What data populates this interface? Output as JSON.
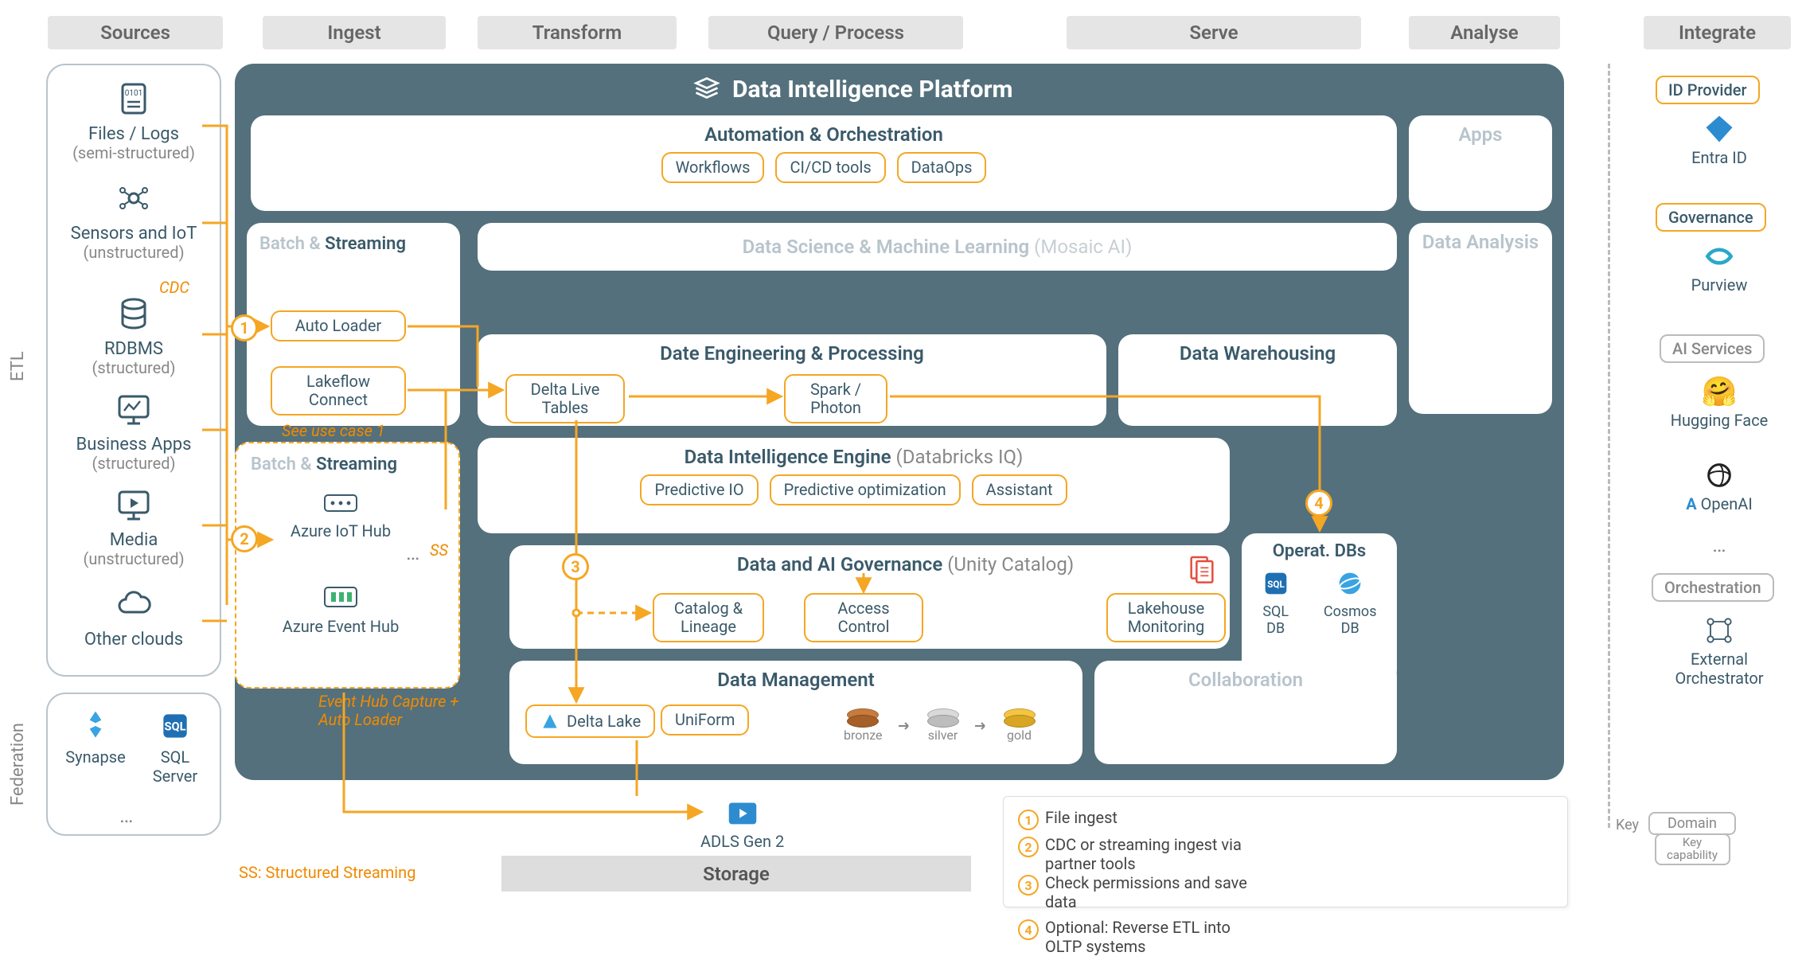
{
  "columns": {
    "sources": "Sources",
    "ingest": "Ingest",
    "transform": "Transform",
    "query": "Query / Process",
    "serve": "Serve",
    "analyse": "Analyse",
    "integrate": "Integrate"
  },
  "side_labels": {
    "etl": "ETL",
    "federation": "Federation"
  },
  "sources": {
    "files": {
      "title": "Files / Logs",
      "sub": "(semi-structured)"
    },
    "sensors": {
      "title": "Sensors and IoT",
      "sub": "(unstructured)"
    },
    "rdbms": {
      "title": "RDBMS",
      "sub": "(structured)",
      "badge": "CDC"
    },
    "bizapps": {
      "title": "Business Apps",
      "sub": "(structured)"
    },
    "media": {
      "title": "Media",
      "sub": "(unstructured)"
    },
    "other": {
      "title": "Other clouds",
      "sub": ""
    }
  },
  "federation": {
    "synapse": "Synapse",
    "sqlserver": "SQL Server",
    "more": "…"
  },
  "platform_title": "Data Intelligence Platform",
  "automation": {
    "title": "Automation & Orchestration",
    "pills": [
      "Workflows",
      "CI/CD tools",
      "DataOps"
    ]
  },
  "apps": {
    "title": "Apps"
  },
  "ingest1": {
    "title_dim": "Batch & ",
    "title_em": "Streaming",
    "auto_loader": "Auto Loader",
    "lakeflow": "Lakeflow Connect",
    "note": "See use case 1"
  },
  "ingest2": {
    "title_dim": "Batch & ",
    "title_em": "Streaming",
    "iot_hub": "Azure IoT Hub",
    "event_hub": "Azure Event Hub",
    "ss_label": "SS",
    "more": "…",
    "note": "Event Hub Capture + Auto Loader"
  },
  "dsml": {
    "title": "Data Science & Machine Learning",
    "paren": "(Mosaic AI)"
  },
  "data_analysis": {
    "title": "Data Analysis"
  },
  "de": {
    "title": "Date Engineering & Processing",
    "dlt": "Delta Live Tables",
    "spark": "Spark / Photon"
  },
  "dw": {
    "title": "Data Warehousing"
  },
  "die": {
    "title": "Data Intelligence Engine",
    "paren": "(Databricks IQ)",
    "pills": [
      "Predictive IO",
      "Predictive optimization",
      "Assistant"
    ]
  },
  "gov": {
    "title": "Data and AI Governance",
    "paren": "(Unity Catalog)",
    "catalog": "Catalog & Lineage",
    "access": "Access Control",
    "lakemon": "Lakehouse Monitoring"
  },
  "odb": {
    "title": "Operat. DBs",
    "sql": "SQL DB",
    "cosmos": "Cosmos DB"
  },
  "dm": {
    "title": "Data Management",
    "delta": "Delta Lake",
    "uniform": "UniForm",
    "bronze": "bronze",
    "silver": "silver",
    "gold": "gold"
  },
  "collab": {
    "title": "Collaboration"
  },
  "storage": {
    "adls": "ADLS Gen 2",
    "label": "Storage"
  },
  "ss_footnote": "SS: Structured Streaming",
  "legend": {
    "1": "File ingest",
    "2": "CDC or streaming ingest via partner tools",
    "3": "Check permissions and save data",
    "4": "Optional: Reverse ETL into OLTP systems"
  },
  "integrate": {
    "id_provider": "ID Provider",
    "entra": "Entra ID",
    "governance": "Governance",
    "purview": "Purview",
    "ai_services": "AI Services",
    "hugging": "Hugging Face",
    "openai": "OpenAI",
    "more": "…",
    "orchestration": "Orchestration",
    "ext_orch": "External Orchestrator"
  },
  "key": {
    "label": "Key",
    "domain": "Domain",
    "cap": "Key capability"
  }
}
